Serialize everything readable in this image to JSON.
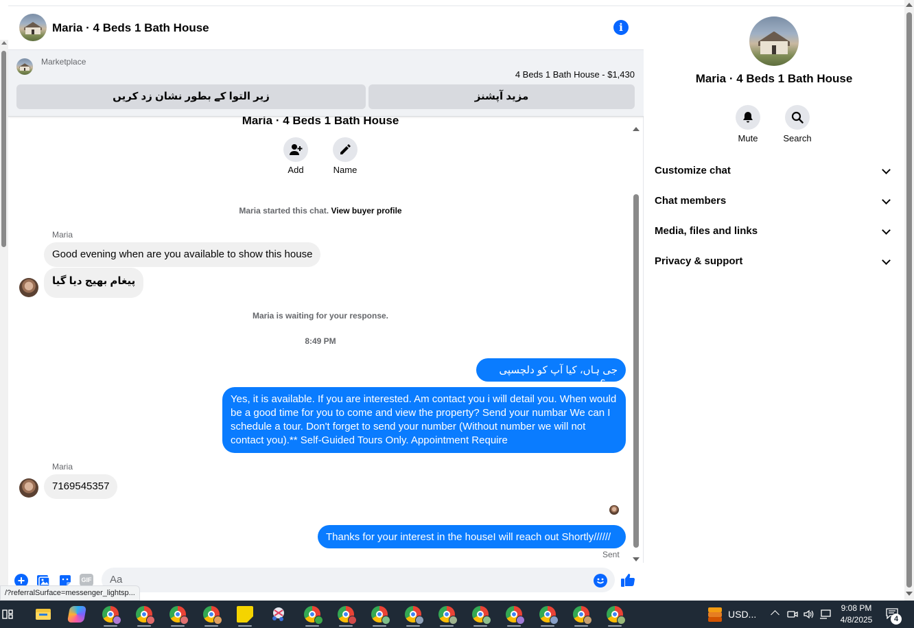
{
  "chat": {
    "title": "Maria · 4 Beds 1 Bath House",
    "marketplace_label": "Marketplace",
    "listing": "4 Beds 1 Bath House - $1,430",
    "mark_button": "زیر التوا کے بطور نشان زد کریں",
    "more_options_button": "مزید آپشنز",
    "cut_title": "Maria · 4 Beds 1 Bath House",
    "add_label": "Add",
    "name_label": "Name",
    "started_text": "Maria started this chat.",
    "view_buyer_profile": "View buyer profile",
    "waiting_text": "Maria is waiting for your response.",
    "time_stamp": "8:49 PM",
    "sent_label": "Sent",
    "composer_placeholder": "Aa"
  },
  "messages": [
    {
      "from": "Maria",
      "sender_label": "Maria",
      "text": "Good evening when are you available to show this house"
    },
    {
      "from": "Maria",
      "text": "پیغام بھیج دیا گیا"
    },
    {
      "from": "me",
      "text": "جی ہاں، کیا آپ کو دلچسپی ہے؟"
    },
    {
      "from": "me",
      "text": "Yes, it is available. If you are interested.  Am contact you i will detail you.  When would be a good time for you to come and view the property? Send your numbar We can I schedule a tour.  Don't forget to send your number (Without number we will not contact you).** Self-Guided Tours Only. Appointment Require"
    },
    {
      "from": "Maria",
      "sender_label": "Maria",
      "text": "7169545357"
    },
    {
      "from": "me",
      "text": "Thanks for your interest in the houseI will reach out Shortly//////"
    }
  ],
  "panel": {
    "title": "Maria · 4 Beds 1 Bath House",
    "mute_label": "Mute",
    "search_label": "Search",
    "sections": [
      "Customize chat",
      "Chat members",
      "Media, files and links",
      "Privacy & support"
    ]
  },
  "status_url": "/?referralSurface=messenger_lightsp...",
  "taskbar": {
    "currency_widget": "USD...",
    "time": "9:08 PM",
    "date": "4/8/2025",
    "notification_count": "4"
  },
  "colors": {
    "messenger_blue": "#0a7cff",
    "accent_blue": "#0866ff",
    "incoming_bubble": "#f0f0f0",
    "taskbar": "#1f2a36"
  }
}
